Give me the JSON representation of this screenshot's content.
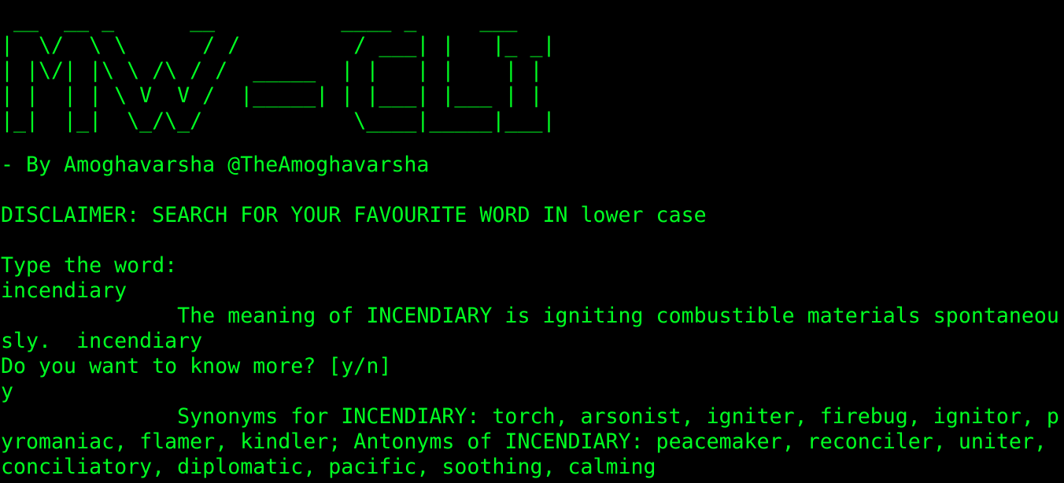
{
  "theme": {
    "background": "#000000",
    "foreground": "#00ff22"
  },
  "banner": [
    " __  __ _      __          ____ _     ___ ",
    "|  \\/  \\ \\      / /         / ___| |   |_ _|",
    "| |\\/| |\\ \\ /\\ / /  _____  | |   | |    | | ",
    "| |  | | \\ V  V /  |_____| | |___| |___ | | ",
    "|_|  |_|  \\_/\\_/            \\____|_____|___|"
  ],
  "output": {
    "byline": "- By Amoghavarsha @TheAmoghavarsha",
    "disclaimer": "DISCLAIMER: SEARCH FOR YOUR FAVOURITE WORD IN lower case",
    "prompt_word": "Type the word:",
    "input_word": "incendiary",
    "meaning_line1": "              The meaning of INCENDIARY is igniting combustible materials spontaneou",
    "meaning_line2": "sly.  incendiary",
    "prompt_more": "Do you want to know more? [y/n]",
    "input_more": "y",
    "synonyms_line1": "              Synonyms for INCENDIARY: torch, arsonist, igniter, firebug, ignitor, p",
    "synonyms_line2": "yromaniac, flamer, kindler; Antonyms of INCENDIARY: peacemaker, reconciler, uniter,",
    "synonyms_line3": "conciliatory, diplomatic, pacific, soothing, calming"
  }
}
